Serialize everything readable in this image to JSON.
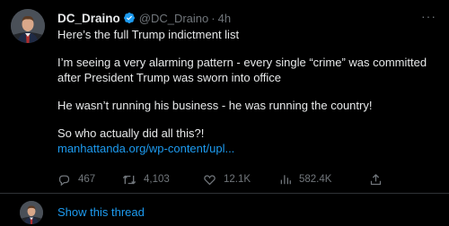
{
  "tweet": {
    "display_name": "DC_Draino",
    "handle": "@DC_Draino",
    "separator": "·",
    "time": "4h",
    "more_label": "···",
    "paragraphs": [
      "Here’s the full Trump indictment list",
      "I’m seeing a very alarming pattern - every single “crime” was committed after President Trump was sworn into office",
      "He wasn’t running his business - he was running the country!",
      "So who actually did all this?!"
    ],
    "link_text": "manhattanda.org/wp-content/upl...",
    "actions": {
      "replies": "467",
      "retweets": "4,103",
      "likes": "12.1K",
      "views": "582.4K"
    },
    "icons": {
      "verified": "verified-badge-icon",
      "reply": "reply-icon",
      "retweet": "retweet-icon",
      "like": "heart-icon",
      "views": "views-icon",
      "share": "share-icon"
    }
  },
  "thread": {
    "show_thread_label": "Show this thread"
  },
  "colors": {
    "background": "#000000",
    "text": "#e7e9ea",
    "muted": "#71767b",
    "accent": "#1d9bf0",
    "divider": "#2f3336"
  }
}
